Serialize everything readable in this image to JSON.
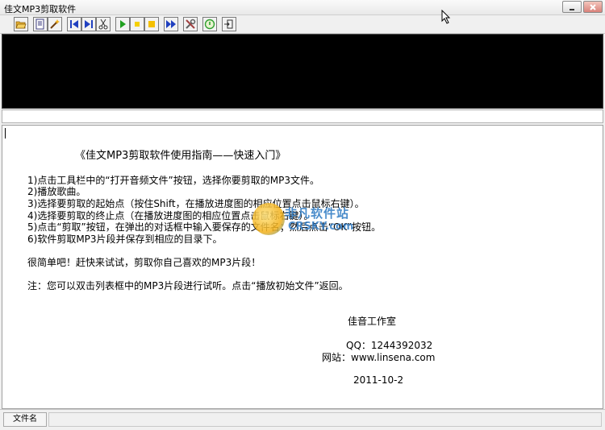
{
  "window": {
    "title": "佳文MP3剪取软件"
  },
  "toolbar": {
    "buttons": [
      {
        "icon": "open-folder-icon",
        "color": "#e0a020"
      },
      {
        "icon": "edit-icon",
        "color": "#404080"
      },
      {
        "icon": "magic-wand-icon",
        "color": "#d09020"
      },
      {
        "icon": "skip-start-icon",
        "color": "#2040c0"
      },
      {
        "icon": "skip-end-icon",
        "color": "#2040c0"
      },
      {
        "icon": "scissors-icon",
        "color": "#404040"
      },
      {
        "icon": "play-icon",
        "color": "#20a020"
      },
      {
        "icon": "pause-icon",
        "color": "#f0c000"
      },
      {
        "icon": "stop-icon",
        "color": "#f0c000"
      },
      {
        "icon": "fast-forward-icon",
        "color": "#2040c0"
      },
      {
        "icon": "tools-icon",
        "color": "#606060"
      },
      {
        "icon": "about-icon",
        "color": "#30a030"
      },
      {
        "icon": "exit-icon",
        "color": "#303030"
      }
    ]
  },
  "content": {
    "title": "《佳文MP3剪取软件使用指南——快速入门》",
    "steps": [
      "1)点击工具栏中的“打开音频文件”按钮，选择你要剪取的MP3文件。",
      "2)播放歌曲。",
      "3)选择要剪取的起始点（按住Shift，在播放进度图的相应位置点击鼠标右键）。",
      "4)选择要剪取的终止点（在播放进度图的相应位置点击鼠标右键）。",
      "5)点击“剪取”按钮，在弹出的对话框中输入要保存的文件名；然后点击“OK”按钮。",
      "6)软件剪取MP3片段并保存到相应的目录下。"
    ],
    "simple": "很简单吧！赶快来试试，剪取你自己喜欢的MP3片段！",
    "note": "注：您可以双击列表框中的MP3片段进行试听。点击“播放初始文件”返回。",
    "studio": "佳音工作室",
    "qq": "QQ：1244392032",
    "website": "网站：www.linsena.com",
    "date": "2011-10-2"
  },
  "watermark": {
    "cn": "非凡软件站",
    "en": "CRSKY.com"
  },
  "statusbar": {
    "pane_label": "文件名"
  }
}
